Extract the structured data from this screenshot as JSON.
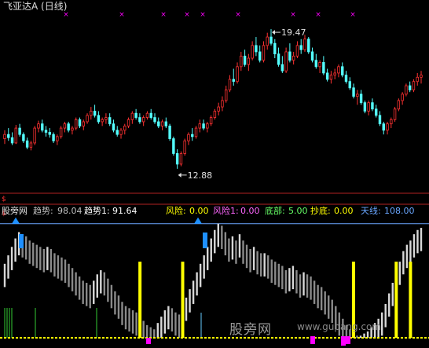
{
  "header": {
    "title": "飞亚达A (日线)"
  },
  "indicator": {
    "name": "股旁网",
    "trend_label": "趋势:",
    "trend_value": "98.04",
    "trend1_label": "趋势1:",
    "trend1_value": "91.64",
    "risk_label": "风险:",
    "risk_value": "0.00",
    "risk1_label": "风险1:",
    "risk1_value": "0.00",
    "bottom_label": "底部:",
    "bottom_value": "5.00",
    "catch_label": "抄底:",
    "catch_value": "0.00",
    "sky_label": "天线:",
    "sky_value": "108.00"
  },
  "price_annotations": {
    "high": "19.47",
    "low": "12.88"
  },
  "watermark": {
    "text": "股旁网",
    "url": "www.gupang.com"
  },
  "colors": {
    "up": "#ff3232",
    "down": "#54ffff",
    "trend": "#a8a8a8",
    "risk": "#ffff00",
    "bottom": "#33cc33",
    "skyline": "#6aa6ff",
    "mark": "#ff00ff",
    "signal_blue": "#1e90ff"
  },
  "chart_data": [
    {
      "type": "candlestick",
      "title": "飞亚达A (日线)",
      "ylim": [
        11.8,
        20.4
      ],
      "annotations": [
        {
          "label": "19.47",
          "index": 71
        },
        {
          "label": "12.88",
          "index": 46
        }
      ],
      "candles": [
        [
          14.3,
          14.7,
          14.05,
          14.5
        ],
        [
          14.5,
          14.8,
          14.2,
          14.35
        ],
        [
          14.35,
          14.6,
          14.0,
          14.1
        ],
        [
          14.1,
          14.95,
          14.05,
          14.8
        ],
        [
          14.8,
          15.0,
          14.4,
          14.5
        ],
        [
          14.5,
          14.6,
          14.1,
          14.2
        ],
        [
          14.2,
          14.35,
          13.8,
          13.9
        ],
        [
          13.9,
          14.2,
          13.75,
          14.1
        ],
        [
          14.1,
          14.9,
          14.0,
          14.8
        ],
        [
          14.8,
          15.15,
          14.6,
          15.0
        ],
        [
          15.0,
          15.2,
          14.6,
          14.7
        ],
        [
          14.7,
          14.9,
          14.4,
          14.6
        ],
        [
          14.6,
          14.8,
          14.35,
          14.5
        ],
        [
          14.5,
          14.6,
          14.1,
          14.2
        ],
        [
          14.2,
          14.5,
          14.0,
          14.4
        ],
        [
          14.4,
          14.9,
          14.3,
          14.8
        ],
        [
          14.8,
          15.1,
          14.6,
          15.0
        ],
        [
          15.0,
          15.1,
          14.6,
          14.7
        ],
        [
          14.7,
          14.9,
          14.5,
          14.8
        ],
        [
          14.8,
          15.3,
          14.7,
          15.2
        ],
        [
          15.2,
          15.3,
          14.8,
          14.9
        ],
        [
          14.9,
          15.2,
          14.7,
          15.1
        ],
        [
          15.1,
          15.5,
          15.0,
          15.4
        ],
        [
          15.4,
          15.8,
          15.2,
          15.6
        ],
        [
          15.6,
          15.9,
          15.3,
          15.4
        ],
        [
          15.4,
          15.6,
          15.0,
          15.1
        ],
        [
          15.1,
          15.3,
          14.9,
          15.2
        ],
        [
          15.2,
          15.5,
          15.0,
          15.3
        ],
        [
          15.3,
          15.5,
          14.9,
          15.0
        ],
        [
          15.0,
          15.2,
          14.6,
          14.7
        ],
        [
          14.7,
          14.9,
          14.4,
          14.5
        ],
        [
          14.5,
          14.8,
          14.3,
          14.7
        ],
        [
          14.7,
          15.0,
          14.5,
          14.9
        ],
        [
          14.9,
          15.3,
          14.8,
          15.2
        ],
        [
          15.2,
          15.6,
          15.0,
          15.5
        ],
        [
          15.5,
          15.7,
          15.2,
          15.3
        ],
        [
          15.3,
          15.5,
          15.0,
          15.1
        ],
        [
          15.1,
          15.4,
          14.9,
          15.3
        ],
        [
          15.3,
          15.6,
          15.2,
          15.5
        ],
        [
          15.5,
          15.7,
          15.2,
          15.3
        ],
        [
          15.3,
          15.5,
          15.0,
          15.1
        ],
        [
          15.1,
          15.3,
          14.8,
          14.9
        ],
        [
          14.9,
          15.2,
          14.7,
          15.1
        ],
        [
          15.1,
          15.3,
          14.8,
          14.9
        ],
        [
          14.9,
          15.0,
          14.2,
          14.3
        ],
        [
          14.3,
          14.4,
          13.5,
          13.6
        ],
        [
          13.6,
          13.8,
          12.88,
          13.1
        ],
        [
          13.1,
          13.7,
          13.0,
          13.6
        ],
        [
          13.6,
          14.3,
          13.5,
          14.2
        ],
        [
          14.2,
          14.6,
          14.0,
          14.5
        ],
        [
          14.5,
          14.8,
          14.2,
          14.4
        ],
        [
          14.4,
          14.9,
          14.3,
          14.8
        ],
        [
          14.8,
          15.2,
          14.6,
          15.0
        ],
        [
          15.0,
          15.2,
          14.7,
          14.8
        ],
        [
          14.8,
          15.1,
          14.6,
          15.0
        ],
        [
          15.0,
          15.4,
          14.9,
          15.3
        ],
        [
          15.3,
          15.7,
          15.2,
          15.6
        ],
        [
          15.6,
          16.0,
          15.4,
          15.8
        ],
        [
          15.8,
          16.3,
          15.6,
          16.1
        ],
        [
          16.1,
          16.8,
          16.0,
          16.6
        ],
        [
          16.6,
          17.3,
          16.5,
          17.1
        ],
        [
          17.1,
          17.6,
          16.8,
          17.0
        ],
        [
          17.0,
          17.9,
          16.9,
          17.7
        ],
        [
          17.7,
          18.4,
          17.5,
          18.2
        ],
        [
          18.2,
          18.5,
          17.7,
          17.8
        ],
        [
          17.8,
          18.3,
          17.5,
          18.1
        ],
        [
          18.1,
          18.9,
          18.0,
          18.7
        ],
        [
          18.7,
          19.1,
          18.2,
          18.4
        ],
        [
          18.4,
          18.7,
          17.9,
          18.0
        ],
        [
          18.0,
          18.9,
          17.9,
          18.7
        ],
        [
          18.7,
          19.3,
          18.5,
          19.1
        ],
        [
          19.1,
          19.47,
          18.7,
          18.8
        ],
        [
          18.8,
          19.0,
          18.1,
          18.3
        ],
        [
          18.3,
          18.6,
          17.7,
          17.8
        ],
        [
          17.8,
          18.2,
          17.4,
          17.5
        ],
        [
          17.5,
          18.6,
          17.4,
          18.4
        ],
        [
          18.4,
          18.8,
          17.9,
          18.0
        ],
        [
          18.0,
          18.4,
          17.8,
          18.2
        ],
        [
          18.2,
          18.9,
          18.1,
          18.7
        ],
        [
          18.7,
          19.0,
          18.3,
          18.5
        ],
        [
          18.5,
          19.2,
          18.4,
          19.0
        ],
        [
          19.0,
          19.1,
          18.3,
          18.4
        ],
        [
          18.4,
          18.6,
          17.9,
          18.0
        ],
        [
          18.0,
          18.3,
          17.6,
          17.7
        ],
        [
          17.7,
          18.0,
          17.4,
          17.9
        ],
        [
          17.9,
          18.2,
          17.3,
          17.4
        ],
        [
          17.4,
          17.6,
          17.0,
          17.1
        ],
        [
          17.1,
          17.5,
          16.9,
          17.3
        ],
        [
          17.3,
          17.6,
          17.1,
          17.4
        ],
        [
          17.4,
          17.8,
          17.2,
          17.7
        ],
        [
          17.7,
          17.9,
          17.2,
          17.3
        ],
        [
          17.3,
          17.5,
          16.9,
          17.0
        ],
        [
          17.0,
          17.2,
          16.6,
          16.7
        ],
        [
          16.7,
          16.9,
          16.2,
          16.3
        ],
        [
          16.3,
          16.6,
          15.9,
          16.4
        ],
        [
          16.4,
          16.6,
          15.9,
          16.0
        ],
        [
          16.0,
          16.1,
          15.5,
          15.6
        ],
        [
          15.6,
          16.1,
          15.4,
          16.0
        ],
        [
          16.0,
          16.2,
          15.6,
          15.7
        ],
        [
          15.7,
          15.9,
          15.3,
          15.4
        ],
        [
          15.4,
          15.6,
          14.9,
          15.0
        ],
        [
          15.0,
          15.1,
          14.5,
          14.7
        ],
        [
          14.7,
          15.1,
          14.5,
          15.0
        ],
        [
          15.0,
          15.3,
          14.8,
          15.2
        ],
        [
          15.2,
          15.8,
          15.1,
          15.7
        ],
        [
          15.7,
          16.2,
          15.6,
          16.1
        ],
        [
          16.1,
          16.5,
          15.9,
          16.4
        ],
        [
          16.4,
          16.9,
          16.3,
          16.8
        ],
        [
          16.8,
          17.0,
          16.5,
          16.6
        ],
        [
          16.6,
          17.1,
          16.5,
          17.0
        ],
        [
          17.0,
          17.4,
          16.8,
          17.2
        ],
        [
          17.2,
          17.5,
          16.9,
          17.3
        ]
      ]
    },
    {
      "type": "bar",
      "title": "股旁网",
      "ylim": [
        0,
        110
      ],
      "series": [
        {
          "name": "趋势",
          "values": [
            70,
            78,
            86,
            94,
            100,
            98,
            96,
            92,
            90,
            88,
            86,
            84,
            86,
            84,
            80,
            78,
            76,
            74,
            70,
            66,
            62,
            58,
            54,
            52,
            50,
            54,
            60,
            64,
            62,
            56,
            50,
            44,
            40,
            34,
            30,
            28,
            26,
            24,
            20,
            16,
            12,
            10,
            8,
            14,
            20,
            26,
            30,
            28,
            24,
            22,
            30,
            38,
            46,
            54,
            62,
            70,
            78,
            86,
            94,
            102,
            108,
            106,
            100,
            94,
            96,
            92,
            98,
            92,
            88,
            84,
            86,
            82,
            80,
            80,
            78,
            74,
            72,
            70,
            68,
            64,
            66,
            68,
            64,
            60,
            62,
            60,
            58,
            54,
            50,
            48,
            44,
            40,
            36,
            30,
            24,
            18,
            12,
            8,
            4,
            2,
            2,
            4,
            6,
            10,
            14,
            18,
            24,
            32,
            42,
            52,
            62,
            72,
            82,
            88,
            92,
            98,
            102,
            104
          ]
        },
        {
          "name": "风险",
          "values": [
            0,
            0,
            0,
            0,
            0,
            0,
            0,
            0,
            0,
            0,
            0,
            0,
            0,
            0,
            0,
            0,
            0,
            0,
            0,
            0,
            0,
            0,
            0,
            0,
            0,
            0,
            0,
            0,
            0,
            0,
            0,
            0,
            0,
            0,
            0,
            0,
            0,
            0,
            72,
            0,
            0,
            0,
            0,
            0,
            0,
            0,
            0,
            0,
            0,
            0,
            72,
            0,
            0,
            0,
            0,
            0,
            0,
            0,
            0,
            0,
            0,
            0,
            0,
            0,
            0,
            0,
            0,
            0,
            0,
            0,
            0,
            0,
            0,
            0,
            0,
            0,
            0,
            0,
            0,
            0,
            0,
            0,
            0,
            0,
            0,
            0,
            0,
            0,
            0,
            0,
            0,
            0,
            0,
            0,
            0,
            0,
            0,
            0,
            72,
            0,
            0,
            0,
            0,
            0,
            0,
            0,
            0,
            0,
            0,
            0,
            72,
            0,
            0,
            0,
            72,
            0,
            0
          ]
        },
        {
          "name": "底部",
          "values": [
            0,
            0,
            0,
            5,
            5,
            5,
            5,
            5,
            5,
            5,
            5,
            5,
            5,
            5,
            5,
            5,
            5,
            5,
            5,
            5,
            5,
            5,
            5,
            5,
            5,
            5,
            5,
            5,
            5,
            5,
            5,
            5,
            5,
            5,
            5,
            5,
            5,
            5,
            5,
            5,
            5,
            5,
            5,
            5,
            5,
            5,
            5,
            5,
            5,
            5,
            5,
            5,
            5,
            5,
            5,
            5,
            5,
            5,
            5,
            5,
            5,
            5,
            5,
            5,
            5,
            5,
            5,
            5,
            5,
            5,
            5,
            5,
            5,
            5,
            5,
            5,
            5,
            5,
            5,
            5,
            5,
            5,
            5,
            5,
            5,
            5,
            5,
            5,
            5,
            5,
            5,
            5,
            5,
            5,
            5,
            5,
            5,
            5,
            5,
            5,
            5,
            5,
            5,
            5,
            5,
            5,
            5,
            5,
            5,
            5,
            5,
            5,
            5,
            5,
            5,
            5,
            5,
            5
          ]
        },
        {
          "name": "天线",
          "values": [
            108,
            108,
            108,
            108,
            108,
            108,
            108,
            108,
            108,
            108,
            108,
            108,
            108,
            108,
            108,
            108,
            108,
            108,
            108,
            108,
            108,
            108,
            108,
            108,
            108,
            108,
            108,
            108,
            108,
            108,
            108,
            108,
            108,
            108,
            108,
            108,
            108,
            108,
            108,
            108,
            108,
            108,
            108,
            108,
            108,
            108,
            108,
            108,
            108,
            108,
            108,
            108,
            108,
            108,
            108,
            108,
            108,
            108,
            108,
            108,
            108,
            108,
            108,
            108,
            108,
            108,
            108,
            108,
            108,
            108,
            108,
            108,
            108,
            108,
            108,
            108,
            108,
            108,
            108,
            108,
            108,
            108,
            108,
            108,
            108,
            108,
            108,
            108,
            108,
            108,
            108,
            108,
            108,
            108,
            108,
            108,
            108,
            108,
            108,
            108,
            108,
            108,
            108,
            108,
            108,
            108,
            108,
            108,
            108,
            108,
            108,
            108,
            108,
            108,
            108,
            108,
            108,
            108
          ]
        }
      ]
    }
  ]
}
